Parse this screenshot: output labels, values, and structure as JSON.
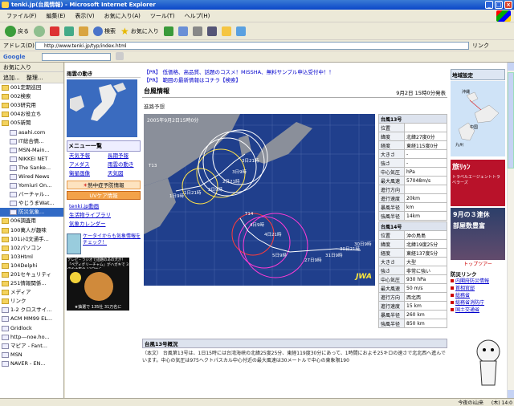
{
  "window": {
    "title": "tenki.jp(台風情報) - Microsoft Internet Explorer"
  },
  "menu": [
    "ファイル(F)",
    "編集(E)",
    "表示(V)",
    "お気に入り(A)",
    "ツール(T)",
    "ヘルプ(H)"
  ],
  "toolbar": {
    "back": "戻る",
    "search": "検索",
    "favorites": "お気に入り"
  },
  "address": {
    "label": "アドレス(D)",
    "url": "http://www.tenki.jp/typ/index.html",
    "go": "リンク"
  },
  "google": {
    "label": "Google"
  },
  "sidebar": {
    "title": "お気に入り",
    "add": "追加...",
    "organize": "整理...",
    "items": [
      "001定期巡回",
      "002検索",
      "003研究用",
      "004お役立ち",
      "005新聞",
      "asahi.com",
      "IT総合情...",
      "MSN-Main...",
      "NIKKEI NET",
      "The Sanke...",
      "Wired News",
      "Yomiuri On...",
      "バーチャル...",
      "やじうまWat...",
      "防災気象...",
      "006調査用",
      "100萬人が趣味",
      "101ﾚﾄﾛ文通手...",
      "102パソコン",
      "103Html",
      "104Delphi",
      "201セキュリティ",
      "251情報関係...",
      "メディア",
      "リンク",
      "1-2 クロスサイ...",
      "ACM MM99 EL...",
      "Gridlock",
      "http---noe.ho...",
      "マピア - Fant...",
      "MSN",
      "NAVER - EN..."
    ]
  },
  "page": {
    "left": {
      "title": "雨雲の動き",
      "menu_title": "メニュー一覧",
      "menu": [
        [
          "天気予報",
          "長期予報"
        ],
        [
          "アメダス",
          "雨雲の動き"
        ],
        [
          "衛星画像",
          "天気図"
        ]
      ],
      "heat": "熱中症予防情報",
      "uv": "UVケア情報",
      "links": [
        "tenki.jp動画",
        "生活物ライブラリ",
        "気象カレンダー"
      ],
      "mobile": "ケータイからも気象情報をチェック！",
      "ad_text": "テレビ・ラジオで話題のあの犬が！「ペディグリーチャム」がハガキで 3倍の主張の 13日から",
      "ad_caption": "★抽選で 135社 31万名に"
    },
    "ads": [
      "【PR】 低価格、高品質、話題のコスメ！MISSHA、無料サンプル申込受付中！！",
      "【PR】 範囲の最新情報はコチラ【検索】"
    ],
    "header": {
      "title": "台風情報",
      "date": "9月2日 15時0分発表"
    },
    "tab": "進路予想",
    "map": {
      "timestamp": "2005年9月2日15時0分",
      "labels": [
        "1日9時",
        "1日21時",
        "2日9時",
        "2日21時",
        "3日9時",
        "3日21時",
        "4日9時",
        "4日21時",
        "5日9時",
        "27日9時",
        "31日9時",
        "30日21時",
        "30日9時",
        "T13",
        "T14"
      ],
      "logo": "JWA"
    },
    "typhoon13": {
      "title": "台風13号",
      "rows": [
        [
          "位置",
          ""
        ],
        [
          "緯度",
          "北緯27度0分"
        ],
        [
          "経度",
          "東経115度0分"
        ],
        [
          "大きさ",
          "-"
        ],
        [
          "強さ",
          "-"
        ],
        [
          "中心気圧",
          "hPa"
        ],
        [
          "最大風速",
          "57048m/s"
        ],
        [
          "進行方向",
          ""
        ],
        [
          "進行速度",
          "20km"
        ],
        [
          "暴風半径",
          "km"
        ],
        [
          "強風半径",
          "14km"
        ]
      ]
    },
    "typhoon14": {
      "title": "台風14号",
      "rows": [
        [
          "位置",
          "沖の鳥島"
        ],
        [
          "緯度",
          "北緯19度25分"
        ],
        [
          "経度",
          "東経137度5分"
        ],
        [
          "大きさ",
          "大型"
        ],
        [
          "強さ",
          "非常に強い"
        ],
        [
          "中心気圧",
          "930 hPa"
        ],
        [
          "最大風速",
          "50 m/s"
        ],
        [
          "進行方向",
          "西北西"
        ],
        [
          "進行速度",
          "15 km"
        ],
        [
          "暴風半径",
          "260 km"
        ],
        [
          "強風半径",
          "850 km"
        ]
      ]
    },
    "overview": {
      "title": "台風13号概況",
      "text": "（本文） 台風第13号は、1日15時には台湾海峡の北緯25度25分、東経119度30分にあって、1時間におよそ25キロの速さで北北西へ進んでいます。中心の気圧は975ヘクトパスカル中心付近の最大風速は30メートルで中心の東象限190"
    },
    "right": {
      "region_title": "地域設定",
      "region_labels": [
        "沖縄",
        "九州",
        "中国"
      ],
      "ad1": "旅ﾘｩﾝ",
      "ad1b": "トラベルエージェントトラベラーズ",
      "ad2": "9月の３連休",
      "ad2b": "部屋数豊富",
      "ad2c": "トップツアー",
      "bosai_title": "防災リンク",
      "bosai": [
        "内閣府防災情報",
        "首相官邸",
        "総務省",
        "総務省消防庁",
        "国土交通省"
      ]
    }
  },
  "status": {
    "tray": "今夜のi山来",
    "time": "(木) 14:0"
  }
}
